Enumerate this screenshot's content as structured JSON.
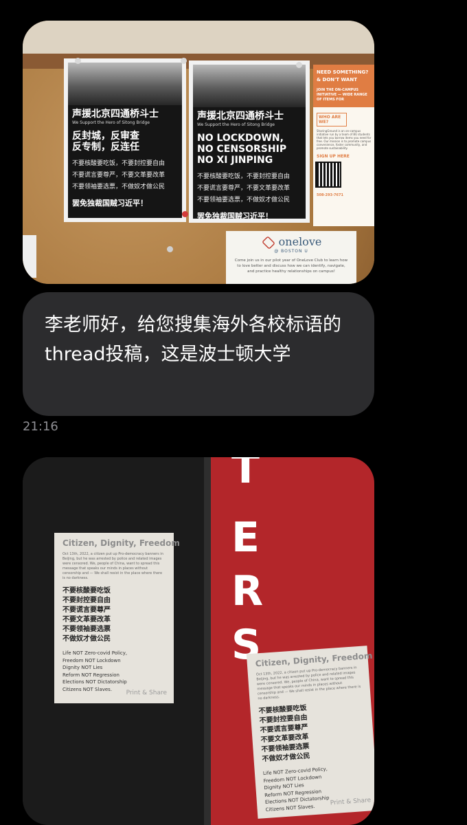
{
  "photo1": {
    "poster_left": {
      "title": "声援北京四通桥斗士",
      "subtitle": "We Support the Hero of Sitong Bridge",
      "slogan": "反封城，反审查\n反专制，反连任",
      "lines": "不要核酸要吃饭，不要封控要自由\n不要谎言要尊严，不要文革要改革\n不要领袖要选票，不做奴才做公民",
      "footer": "罢免独裁国贼习近平！"
    },
    "poster_right": {
      "title": "声援北京四通桥斗士",
      "subtitle": "We Support the Hero of Sitong Bridge",
      "slogan": "NO LOCKDOWN,\nNO CENSORSHIP\nNO XI JINPING",
      "lines": "不要核酸要吃饭，不要封控要自由\n不要谎言要尊严，不要文革要改革\n不要领袖要选票，不做奴才做公民",
      "footer": "罢免独裁国贼习近平！"
    },
    "orange_flyer": {
      "heading": "NEED SOMETHING? & DON'T WANT",
      "sub": "JOIN THE ON-CAMPUS INITIATIVE — WIDE RANGE OF ITEMS FOR",
      "who": "WHO ARE WE?",
      "body": "SharingGround is an on-campus initiative run by a team of BU students that lets you borrow items you need for free. Our mission is to promote campus convenience, foster community, and promote sustainability.",
      "signup": "SIGN UP HERE",
      "phone": "508-293-7671"
    },
    "onelove": {
      "logo": "onelove",
      "at": "@ BOSTON U",
      "text": "Come join us in our pilot year of OneLove Club to learn how to love better and discuss how we can identify, navigate, and practice healthy relationships on campus!"
    }
  },
  "message": {
    "text": "李老师好，给您搜集海外各校标语的thread投稿，这是波士顿大学",
    "time": "21:16"
  },
  "photo2": {
    "letters": [
      "T",
      "E",
      "R",
      "S"
    ],
    "flyer": {
      "title": "Citizen, Dignity, Freedom",
      "body": "Oct 13th, 2022, a citizen put up Pro-democracy banners in Beijing, but he was arrested by police and related images were censored. We, people of China, want to spread this message that speaks our minds in places without censorship and — We shall resist in the place where there is no darkness.",
      "cn": "不要核酸要吃饭\n不要封控要自由\n不要谎言要尊严\n不要文革要改革\n不要领袖要选票\n不做奴才做公民",
      "en": "Life NOT Zero-covid Policy,\nFreedom NOT Lockdown\nDignity NOT Lies\nReform NOT Regression\nElections NOT Dictatorship\nCitizens NOT Slaves.",
      "share": "Print & Share"
    }
  }
}
